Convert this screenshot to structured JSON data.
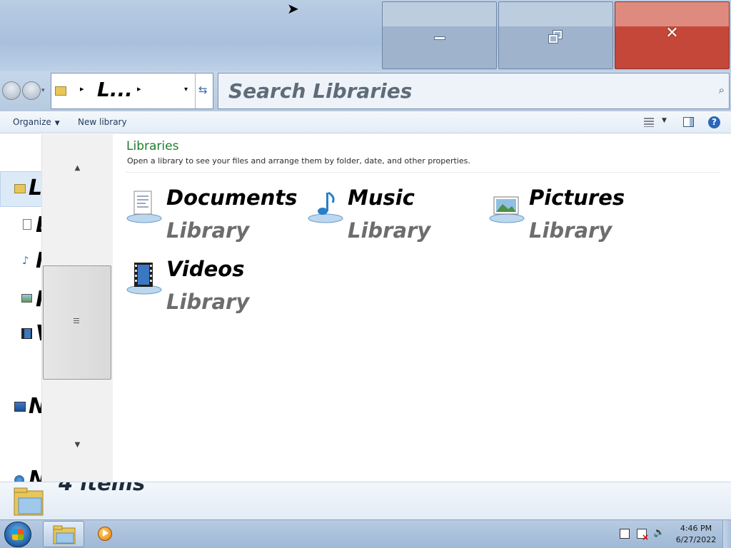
{
  "window": {
    "title_buttons": {
      "minimize": "minimize-icon",
      "restore": "restore-icon",
      "close": "close-icon",
      "close_color": "#c4473a"
    }
  },
  "nav": {
    "address_crumb": "L...",
    "search_placeholder": "Search Libraries"
  },
  "commandbar": {
    "organize_label": "Organize",
    "new_library_label": "New library"
  },
  "navpane": {
    "items": [
      {
        "icon": "libraries-icon",
        "label": "L"
      },
      {
        "icon": "document-icon",
        "label": "D"
      },
      {
        "icon": "music-icon",
        "label": "M"
      },
      {
        "icon": "pictures-icon",
        "label": "P"
      },
      {
        "icon": "videos-icon",
        "label": "V"
      },
      {
        "icon": "network-icon",
        "label": "N"
      },
      {
        "icon": "homegroup-icon",
        "label": "N"
      }
    ]
  },
  "content": {
    "title": "Libraries",
    "description": "Open a library to see your files and arrange them by folder, date, and other properties.",
    "title_color": "#1e7d2c",
    "libraries": [
      {
        "name": "Documents",
        "type": "Library",
        "icon": "documents-library-icon"
      },
      {
        "name": "Music",
        "type": "Library",
        "icon": "music-library-icon"
      },
      {
        "name": "Pictures",
        "type": "Library",
        "icon": "pictures-library-icon"
      },
      {
        "name": "Videos",
        "type": "Library",
        "icon": "videos-library-icon"
      }
    ]
  },
  "details": {
    "count": "4 items"
  },
  "taskbar": {
    "time": "4:46 PM",
    "date": "6/27/2022"
  }
}
